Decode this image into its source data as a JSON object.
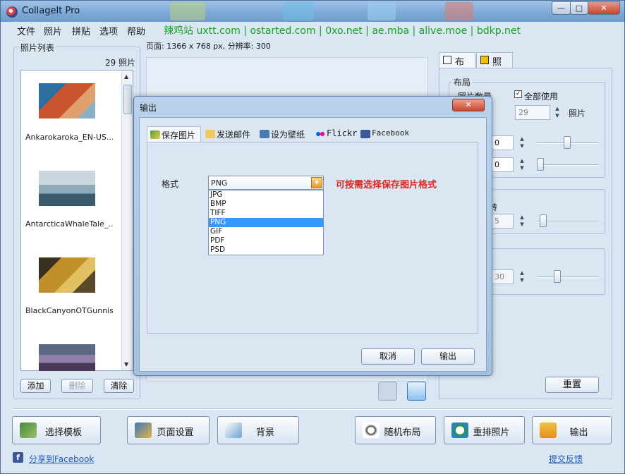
{
  "window": {
    "title": "CollageIt Pro",
    "min_label": "—",
    "max_label": "□",
    "close_label": "✕"
  },
  "menu": {
    "items": [
      "文件",
      "照片",
      "拼贴",
      "选项",
      "帮助"
    ],
    "links": "辣鸡站 uxtt.com | ostarted.com | 0xo.net | ae.mba | alive.moe | bdkp.net"
  },
  "photo_panel": {
    "group_label": "照片列表",
    "count": "29 照片",
    "photos": [
      {
        "caption": "Ankarokaroka_EN-US..."
      },
      {
        "caption": "AntarcticaWhaleTale_..."
      },
      {
        "caption": "BlackCanyonOTGunnis..."
      },
      {
        "caption": ""
      }
    ],
    "add_label": "添加",
    "delete_label": "删除",
    "clear_label": "清除"
  },
  "page_info": "页面: 1366 x 768 px, 分辨率: 300",
  "right_panel": {
    "tab_layout": "布局",
    "tab_photo": "照片",
    "group_layout": "布局",
    "photo_count_label": "照片数量",
    "use_all_label": "全部使用",
    "photo_count_value": "29",
    "photo_unit": "照片",
    "spin_a": "0",
    "spin_b": "0",
    "rotate_frag": "转",
    "spin_c": "5",
    "spin_d": "30",
    "reset_label": "重置"
  },
  "bottom": {
    "select_template": "选择模板",
    "page_setup": "页面设置",
    "background": "背景",
    "random_layout": "随机布局",
    "reorder_photos": "重排照片",
    "export": "输出",
    "share_facebook": "分享到Facebook",
    "feedback": "提交反馈"
  },
  "dialog": {
    "title": "输出",
    "close": "✕",
    "tabs": [
      "保存图片",
      "发送邮件",
      "设为壁纸",
      "Flickr",
      "Facebook"
    ],
    "format_label": "格式",
    "selected_format": "PNG",
    "format_options": [
      "JPG",
      "BMP",
      "TIFF",
      "PNG",
      "GIF",
      "PDF",
      "PSD"
    ],
    "note": "可按需选择保存图片格式",
    "cancel_label": "取消",
    "ok_label": "输出"
  },
  "colors": {
    "accent_link": "#1b58b8",
    "note_red": "#e0261e",
    "menu_link_green": "#15a320",
    "selected_option": "#3399ff"
  }
}
